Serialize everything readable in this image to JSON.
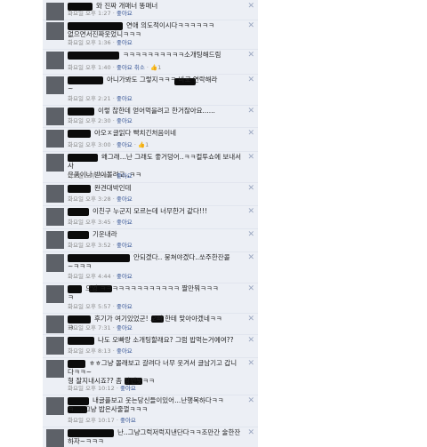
{
  "feed": {
    "close_glyph": "✕",
    "comments": [
      {
        "text": "와 진짜 개매너 똥매너",
        "time": "화요일 오후 1:27",
        "like": "좋아요",
        "unlike": "",
        "count": ""
      },
      {
        "text": "연애 의도적이시다ㅋㅋㅋㅋㅋㅋ\n없으면서진짜웃었니ㅋㅋㅋ",
        "time": "화요일 오후 1:36",
        "like": "좋아요",
        "unlike": "",
        "count": ""
      },
      {
        "text": "ㅋㅋㅋㅋㅋㅋㅋㅋㅋㅋ소개팅해드림",
        "time": "화요일 오후 1:40",
        "like": "좋아요",
        "unlike": "취소",
        "count": "1"
      },
      {
        "text": "아니가봐도 그렇지ㅋㅋㅋ 바로 연락해라\n~",
        "time": "화요일 오후 2:21",
        "like": "좋아요",
        "unlike": "",
        "count": ""
      },
      {
        "text": "이렇 찮한데 얻어먹을려고 한거잖아요......",
        "time": "화요일 오후 2:30",
        "like": "좋아요",
        "unlike": "",
        "count": ""
      },
      {
        "text": "아오ㅈ글읽다 빡치긴처음이네",
        "time": "화요일 오후 3:00",
        "like": "좋아요",
        "unlike": "",
        "count": "1"
      },
      {
        "text": "왜그래...난 그래도 좋거덩어..ㅋㅋ컬투쇼에 보내서 사\n은품이나 받아볼려고..ㅋㅋ",
        "time": "화요일 오후 3:01",
        "like": "좋아요",
        "unlike": "",
        "count": ""
      },
      {
        "text": "완견대박인데",
        "time": "화요일 오후 3:28",
        "like": "좋아요",
        "unlike": "",
        "count": ""
      },
      {
        "text": "이친구 누군지 모르는데 너무한거 같다!!!",
        "time": "화요일 오후 3:45",
        "like": "좋아요",
        "unlike": "",
        "count": ""
      },
      {
        "text": "기운내라",
        "time": "화요일 오후 3:52",
        "like": "좋아요",
        "unlike": "",
        "count": ""
      },
      {
        "text": "안되겠다.. 뭉쳐야겠다..쏘주한잔콜\n~ㅋㅋㅋ",
        "time": "화요일 오후 4:44",
        "like": "좋아요",
        "unlike": "",
        "count": ""
      },
      {
        "text": "으엉 ㅋㅋㅋㅋㅋㅋㅋㅋㅋㅋㅋㅋㅋ 짤만뭐ㅋㅋㅋ\nㅋ",
        "time": "화요일 오후 5:57",
        "like": "좋아요",
        "unlike": "",
        "count": ""
      },
      {
        "text": "후기가 여기있었군! 오빠 한테 맞아야겠네ㅋㅋ\nㅋ",
        "time": "화요일 오후 7:31",
        "like": "좋아요",
        "unlike": "",
        "count": ""
      },
      {
        "text": "나도 오빠랑 소개팅할래요? 그럼 밥먹는거예여??",
        "time": "화요일 오후 8:13",
        "like": "좋아요",
        "unlike": "",
        "count": ""
      },
      {
        "text": "ㅎㅎ그냥 몰래보고 갈려다 너무 웃겨서 글남기고 갑니\n다ㅋㅋ~\n형 잘지내시죠?? 좀 장인듯ㅋㅋ",
        "time": "화요일 오후 10:12",
        "like": "좋아요",
        "unlike": "",
        "count": ""
      },
      {
        "text": "내글플보고 웃는당신들이있어...난행복하다ㅋㅋ\nㅋ.....그냥 밥은사줄껄ㅋㅋㅋ",
        "time": "화요일 오후 10:17",
        "like": "좋아요",
        "unlike": "",
        "count": ""
      },
      {
        "text": "난..그냥그럭저럭지낸단다ㅋㅋ조만간 술한잔\n하자~ㅋㅋㅋ",
        "time": "",
        "like": "",
        "unlike": "",
        "count": ""
      }
    ]
  }
}
